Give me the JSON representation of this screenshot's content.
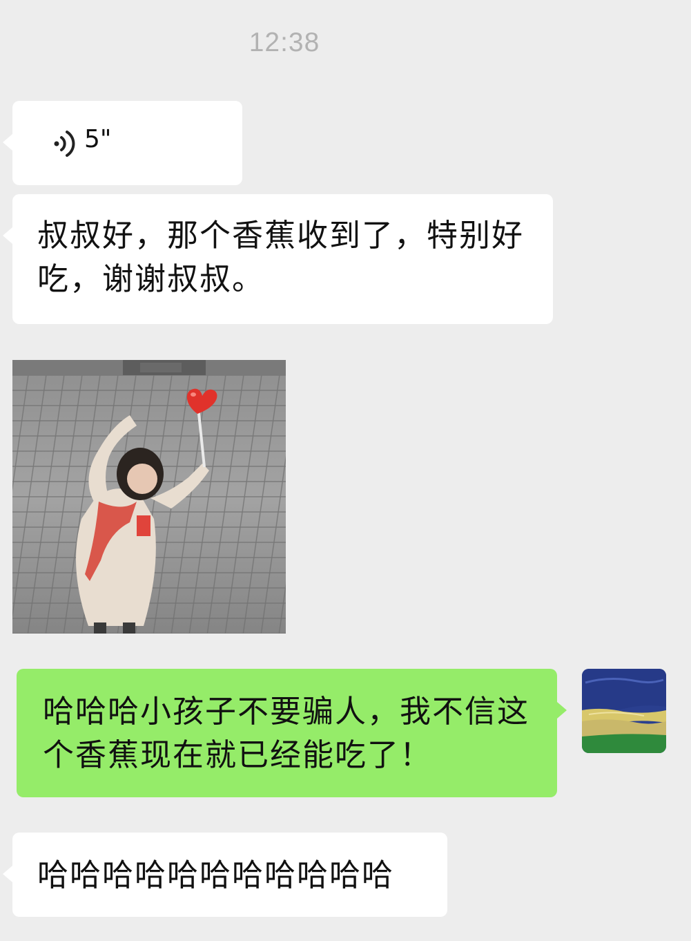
{
  "timestamp": "12:38",
  "messages": {
    "voice": {
      "duration": "5\"",
      "icon": "voice-wave-icon"
    },
    "text1": "叔叔好，那个香蕉收到了，特别好吃，谢谢叔叔。",
    "image1": {
      "icon": "heart-icon"
    },
    "text2": "哈哈哈小孩子不要骗人，我不信这个香蕉现在就已经能吃了！",
    "text3": "哈哈哈哈哈哈哈哈哈哈哈"
  },
  "colors": {
    "background": "#ededed",
    "incoming_bubble": "#ffffff",
    "outgoing_bubble": "#95ec69",
    "timestamp": "#b2b2b2",
    "heart": "#e0322b"
  }
}
